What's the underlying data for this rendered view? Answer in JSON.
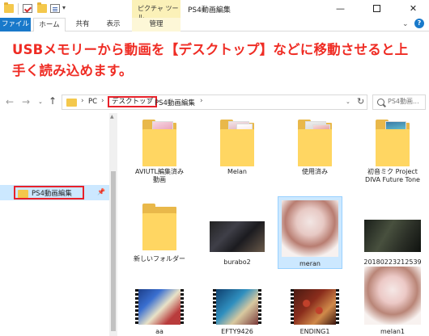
{
  "titlebar": {
    "contextual_tab_header": "ピクチャ ツール",
    "window_title": "PS4動画編集",
    "qa_dropdown": "▾",
    "minimize": "—",
    "close": "✕"
  },
  "ribbon": {
    "tabs": [
      "ファイル",
      "ホーム",
      "共有",
      "表示",
      "管理"
    ],
    "collapse": "⌄",
    "help": "?"
  },
  "annotation": {
    "text": "USBメモリーから動画を【デスクトップ】などに移動させると上手く読み込めます。",
    "color": "#ef2c24"
  },
  "address": {
    "back": "←",
    "forward": "→",
    "recent": "⌄",
    "up": "↑",
    "separator": "›",
    "crumbs": [
      "PC",
      "デスクトップ",
      "PS4動画編集"
    ],
    "dropdown": "⌄",
    "refresh": "↻",
    "search_placeholder": "PS4動画..."
  },
  "nav_pane": {
    "selected_item": "PS4動画編集",
    "pin": "📌",
    "scroll_up": "▲",
    "highlight_color": "#e8212a"
  },
  "items": [
    {
      "name": "AVIUTL編集済み\n動画",
      "kind": "folder"
    },
    {
      "name": "Melan",
      "kind": "folder"
    },
    {
      "name": "使用済み",
      "kind": "folder"
    },
    {
      "name": "初音ミク Project\nDIVA Future Tone",
      "kind": "folder"
    },
    {
      "name": "新しいフォルダー",
      "kind": "folder"
    },
    {
      "name": "burabo2",
      "kind": "video"
    },
    {
      "name": "meran",
      "kind": "image",
      "selected": true
    },
    {
      "name": "20180223212539",
      "kind": "video"
    },
    {
      "name": "aa",
      "kind": "video"
    },
    {
      "name": "EFTY9426",
      "kind": "video"
    },
    {
      "name": "ENDING1",
      "kind": "video"
    },
    {
      "name": "melan1",
      "kind": "image"
    }
  ],
  "colors": {
    "file_tab": "#1979ca",
    "folder": "#ffd662",
    "selection": "#cce8ff"
  }
}
